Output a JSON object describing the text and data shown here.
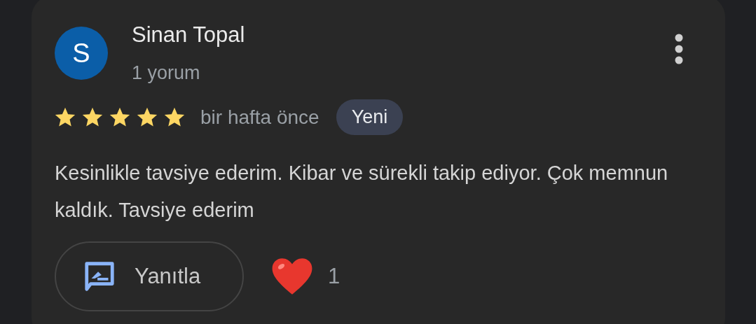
{
  "review": {
    "avatar_letter": "S",
    "name": "Sinan Topal",
    "review_count": "1 yorum",
    "stars": 5,
    "time": "bir hafta önce",
    "badge": "Yeni",
    "text": "Kesinlikle tavsiye ederim. Kibar ve sürekli takip ediyor. Çok memnun kaldık. Tavsiye ederim",
    "reply_button": "Yanıtla",
    "reaction_count": "1"
  }
}
